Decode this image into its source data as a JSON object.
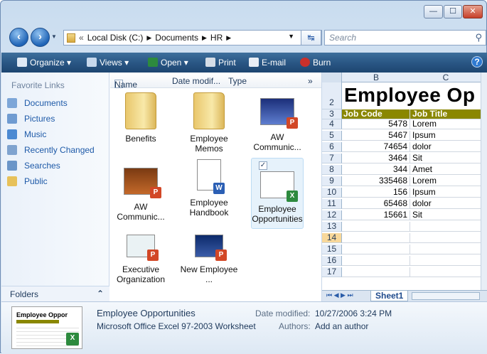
{
  "window": {
    "controls": {
      "minimize": "—",
      "maximize": "☐",
      "close": "✕"
    }
  },
  "nav": {
    "back_icon": "back-arrow-icon",
    "forward_icon": "forward-arrow-icon",
    "breadcrumb": [
      "Local Disk (C:)",
      "Documents",
      "HR"
    ],
    "search_placeholder": "Search"
  },
  "toolbar": {
    "organize": "Organize",
    "views": "Views",
    "open": "Open",
    "print": "Print",
    "email": "E-mail",
    "burn": "Burn",
    "help": "?"
  },
  "navpane": {
    "header": "Favorite Links",
    "links": [
      "Documents",
      "Pictures",
      "Music",
      "Recently Changed",
      "Searches",
      "Public"
    ],
    "folders_label": "Folders"
  },
  "columns": {
    "name": "Name",
    "date": "Date modif...",
    "type": "Type",
    "more": "»"
  },
  "files": [
    {
      "label": "Benefits",
      "kind": "folder"
    },
    {
      "label": "Employee Memos",
      "kind": "folder"
    },
    {
      "label": "AW Communic...",
      "kind": "ppt"
    },
    {
      "label": "AW Communic...",
      "kind": "ppt"
    },
    {
      "label": "Employee Handbook",
      "kind": "doc"
    },
    {
      "label": "Employee Opportunities",
      "kind": "xls"
    },
    {
      "label": "Executive Organization",
      "kind": "ppt"
    },
    {
      "label": "New Employee ...",
      "kind": "ppt"
    }
  ],
  "preview": {
    "col_b": "B",
    "col_c": "C",
    "title": "Employee Op",
    "header_job_code": "Job Code",
    "header_job_title": "Job Title",
    "rows": [
      {
        "n": "4",
        "code": "5478",
        "title": "Lorem"
      },
      {
        "n": "5",
        "code": "5467",
        "title": "Ipsum"
      },
      {
        "n": "6",
        "code": "74654",
        "title": "dolor"
      },
      {
        "n": "7",
        "code": "3464",
        "title": "Sit"
      },
      {
        "n": "8",
        "code": "344",
        "title": "Amet"
      },
      {
        "n": "9",
        "code": "335468",
        "title": "Lorem"
      },
      {
        "n": "10",
        "code": "156",
        "title": "Ipsum"
      },
      {
        "n": "11",
        "code": "65468",
        "title": "dolor"
      },
      {
        "n": "12",
        "code": "15661",
        "title": "Sit"
      },
      {
        "n": "13",
        "code": "",
        "title": ""
      },
      {
        "n": "14",
        "code": "",
        "title": ""
      },
      {
        "n": "15",
        "code": "",
        "title": ""
      },
      {
        "n": "16",
        "code": "",
        "title": ""
      },
      {
        "n": "17",
        "code": "",
        "title": ""
      }
    ],
    "row2": "2",
    "row3": "3",
    "sheet_tab": "Sheet1"
  },
  "details": {
    "name": "Employee Opportunities",
    "type": "Microsoft Office Excel 97-2003 Worksheet",
    "date_label": "Date modified:",
    "date_value": "10/27/2006 3:24 PM",
    "authors_label": "Authors:",
    "authors_value": "Add an author",
    "thumb_title": "Employee Oppor"
  },
  "colors": {
    "toolbar": "#2a5785",
    "header_fill": "#8a8700",
    "link": "#1e5aa8"
  }
}
